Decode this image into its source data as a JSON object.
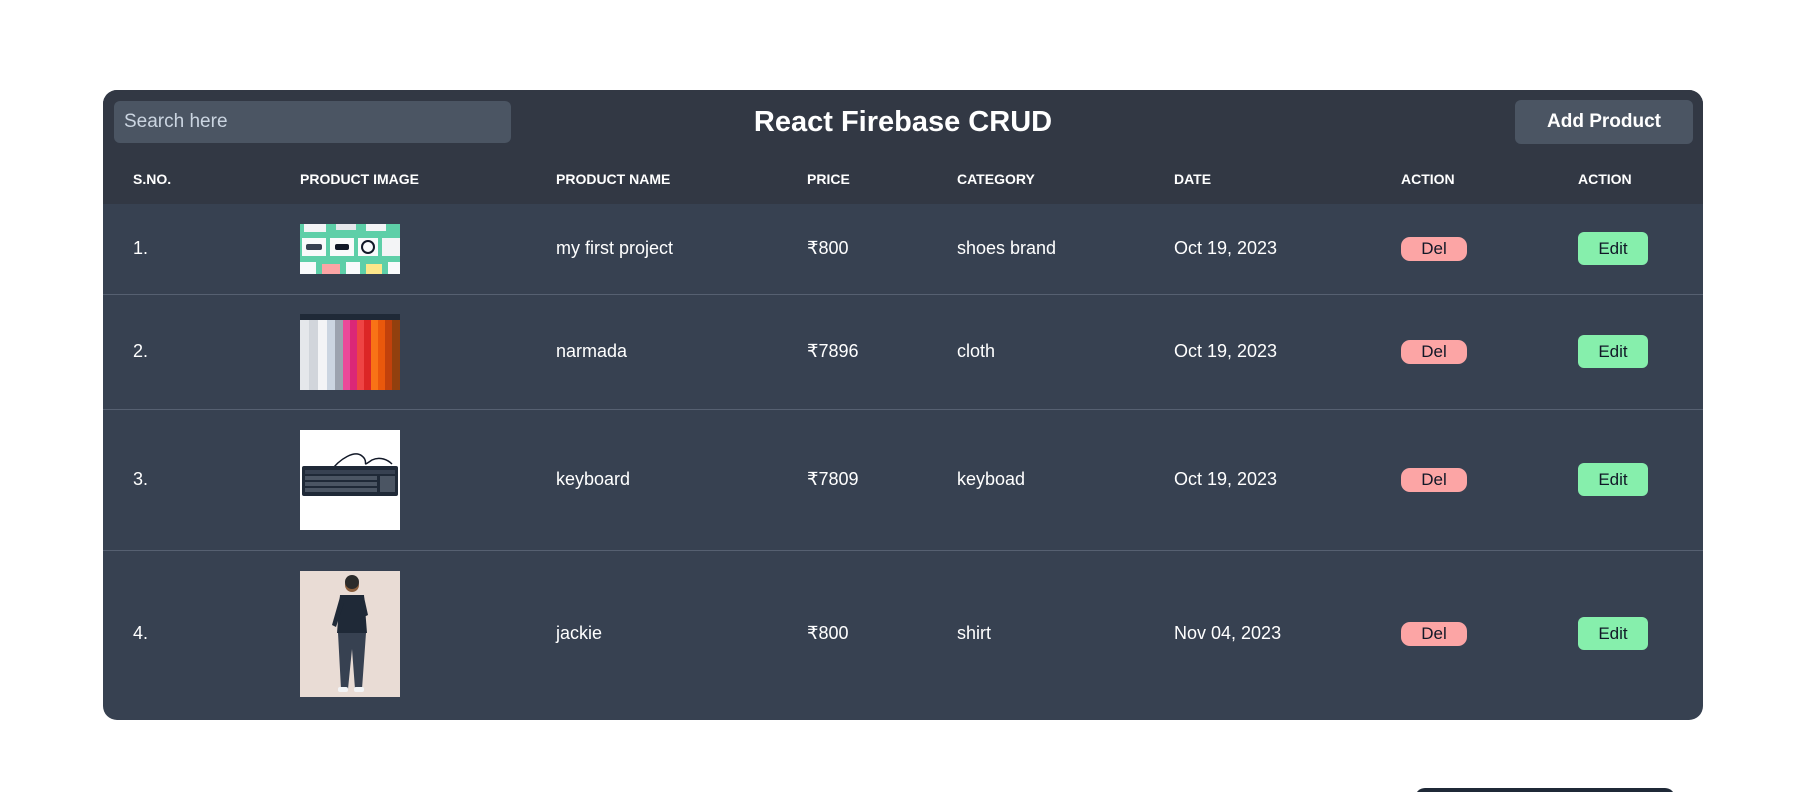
{
  "header": {
    "search_placeholder": "Search here",
    "title": "React Firebase CRUD",
    "add_button_label": "Add Product"
  },
  "table": {
    "columns": [
      "S.NO.",
      "PRODUCT IMAGE",
      "PRODUCT NAME",
      "PRICE",
      "CATEGORY",
      "DATE",
      "ACTION",
      "ACTION"
    ],
    "rows": [
      {
        "sno": "1.",
        "image_icon": "shoes-collage-image",
        "name": "my first project",
        "price": "₹800",
        "category": "shoes brand",
        "date": "Oct 19, 2023",
        "del": "Del",
        "edit": "Edit"
      },
      {
        "sno": "2.",
        "image_icon": "clothes-rack-image",
        "name": "narmada",
        "price": "₹7896",
        "category": "cloth",
        "date": "Oct 19, 2023",
        "del": "Del",
        "edit": "Edit"
      },
      {
        "sno": "3.",
        "image_icon": "keyboard-image",
        "name": "keyboard",
        "price": "₹7809",
        "category": "keyboad",
        "date": "Oct 19, 2023",
        "del": "Del",
        "edit": "Edit"
      },
      {
        "sno": "4.",
        "image_icon": "man-in-shirt-image",
        "name": "jackie",
        "price": "₹800",
        "category": "shirt",
        "date": "Nov 04, 2023",
        "del": "Del",
        "edit": "Edit"
      }
    ]
  },
  "colors": {
    "page_bg": "#ffffff",
    "card_bg": "#374151",
    "header_bg": "#323844",
    "del_bg": "#fca5a5",
    "edit_bg": "#86efac"
  }
}
